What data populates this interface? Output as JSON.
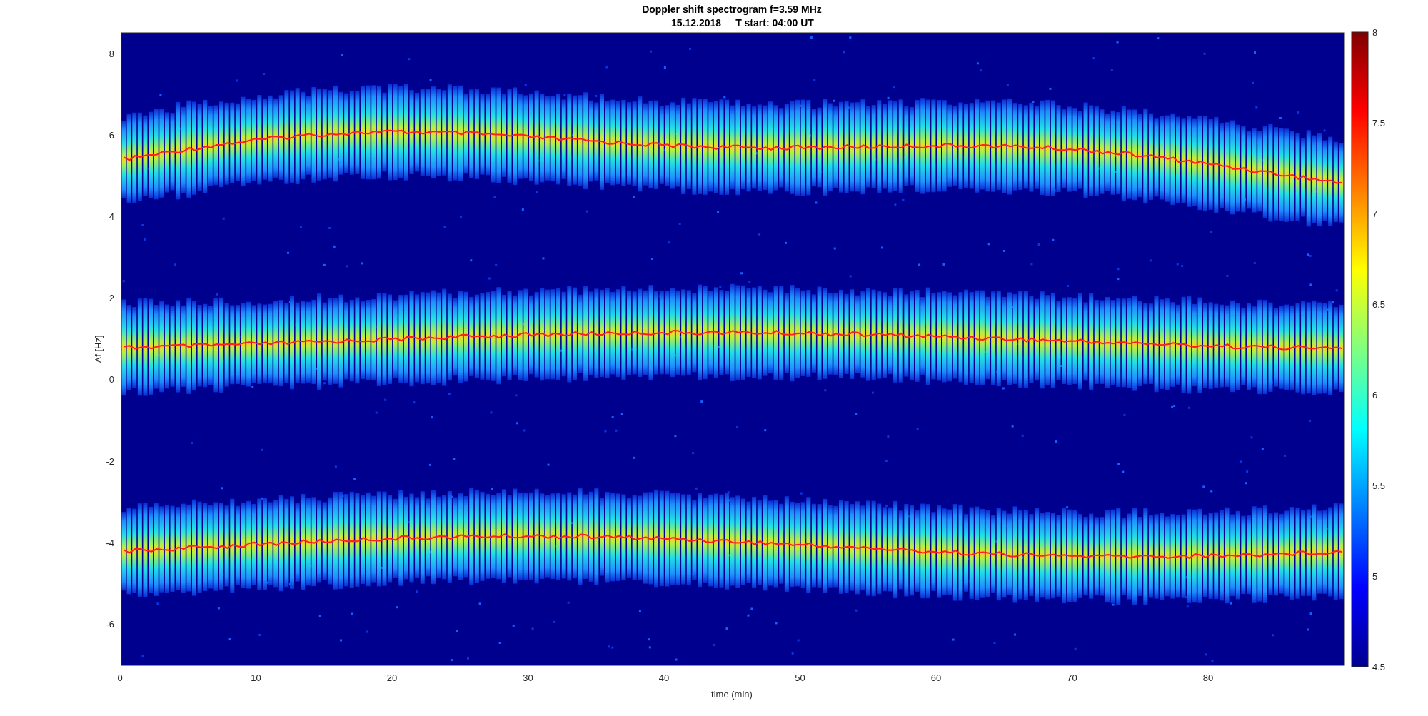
{
  "title": {
    "line_1": "Doppler shift spectrogram f=3.59 MHz",
    "date": "15.12.2018",
    "start": "T start: 04:00 UT"
  },
  "x_axis": {
    "label": "time (min)",
    "ticks": [
      "0",
      "10",
      "20",
      "30",
      "40",
      "50",
      "60",
      "70",
      "80"
    ]
  },
  "y_axis": {
    "label": "Δf [Hz]",
    "ticks": [
      "8",
      "6",
      "4",
      "2",
      "0",
      "-2",
      "-4",
      "-6"
    ]
  },
  "colorbar": {
    "ticks": [
      "8",
      "7.5",
      "7",
      "6.5",
      "6",
      "5.5",
      "5",
      "4.5"
    ]
  }
}
